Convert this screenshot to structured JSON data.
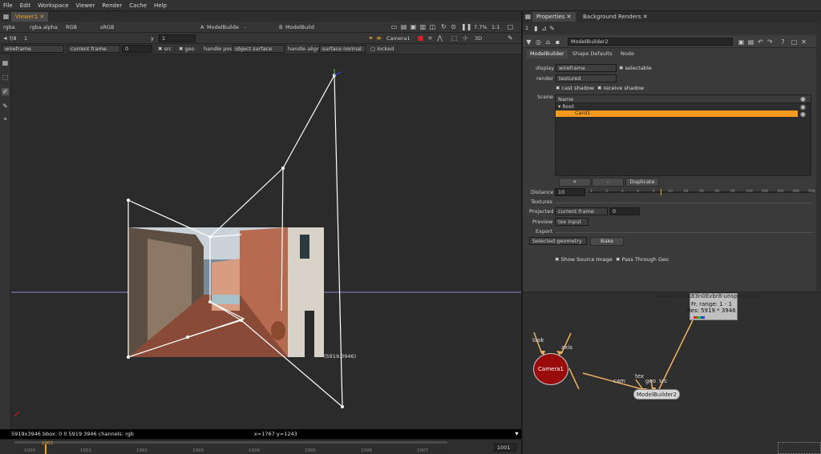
{
  "menu": [
    "File",
    "Edit",
    "Workspace",
    "Viewer",
    "Render",
    "Cache",
    "Help"
  ],
  "viewer": {
    "tab": "Viewer1",
    "channels": "rgba",
    "alpha": "rgba.alpha",
    "colorspace_mode": "RGB",
    "lut": "sRGB",
    "input_a": "ModelBuilde",
    "input_a_op": "-",
    "input_b": "ModelBuild",
    "zoom": "7.7%",
    "ratio": "1:1",
    "fstop": "f/8",
    "frame_lbl": "1",
    "y_lbl": "y",
    "y_val": "1",
    "camera": "Camera1",
    "view_mode": "3D",
    "display_mode": "wireframe",
    "frame_mode": "current frame",
    "frame_val": "0",
    "src_lbl": "src",
    "geo_lbl": "geo",
    "handle_pos_lbl": "handle pos",
    "handle_pos": "object surface",
    "handle_align_lbl": "handle align",
    "handle_align": "surface normal",
    "locked_lbl": "locked",
    "bbox_label": "(5919,3946)",
    "status_left": "5919x3946  bbox: 0 0 5919 3946 channels: rgb",
    "status_coords": "x=1767 y=1243",
    "timeline_start": "1001",
    "timeline_ticks": [
      "1000",
      "1001",
      "1002",
      "1003",
      "1004",
      "1005",
      "1006",
      "1007"
    ],
    "timeline_end": "1001"
  },
  "properties": {
    "tab_properties": "Properties",
    "tab_background": "Background Renders",
    "node_name": "ModelBuilder2",
    "tabs": [
      "ModelBuilder",
      "Shape Defaults",
      "Node"
    ],
    "display_lbl": "display",
    "display_val": "wireframe",
    "selectable_lbl": "selectable",
    "render_lbl": "render",
    "render_val": "textured",
    "cast_shadow_lbl": "cast shadow",
    "receive_shadow_lbl": "receive shadow",
    "scene_lbl": "Scene",
    "scene_header": "Name",
    "scene_root": "Root",
    "scene_card": "Card1",
    "add_btn": "+",
    "remove_btn": "-",
    "duplicate_btn": "Duplicate",
    "distance_lbl": "Distance",
    "distance_val": "10",
    "slider_ticks": [
      "1",
      "2",
      "3",
      "4",
      "5",
      "10",
      "20",
      "30",
      "40",
      "50",
      "100",
      "200",
      "300",
      "400",
      "500"
    ],
    "textures_lbl": "Textures",
    "projected_lbl": "Projected",
    "projected_val": "current frame",
    "projected_frame": "0",
    "preview_lbl": "Preview",
    "preview_val": "tex input",
    "export_lbl": "Export",
    "export_val": "Selected geometry",
    "bake_btn": "Bake",
    "show_source_lbl": "Show Source Image",
    "pass_through_lbl": "Pass Through Geo"
  },
  "nodegraph": {
    "read_title": "iatla-bravo-K83n0Evbr8-unsplash.jpg",
    "read_range": "Fr. range: 1 - 1",
    "read_res": "Res: 5919 * 3946",
    "camera_node": "Camera1",
    "camera_inputs": [
      "look",
      "axis"
    ],
    "builder_node": "ModelBuilder2",
    "builder_inputs": [
      "cam",
      "tex",
      "geo",
      "src"
    ]
  },
  "colors": {
    "accent": "#f0a030",
    "selection": "#f39a1c",
    "camera_node": "#9a0c0c",
    "wire": "#f0b060"
  }
}
